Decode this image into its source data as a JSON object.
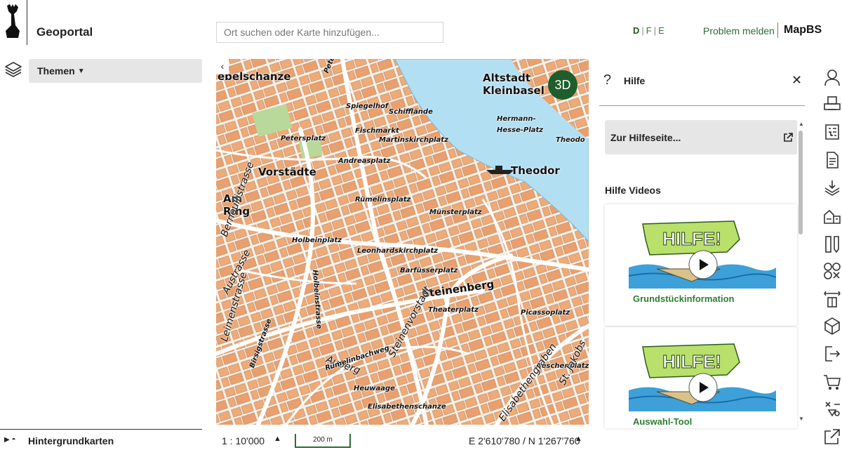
{
  "header": {
    "title": "Geoportal",
    "search_placeholder": "Ort suchen oder Karte hinzufügen...",
    "languages": [
      "D",
      "F",
      "E"
    ],
    "active_language": "D",
    "problem_link": "Problem melden",
    "brand": "MapBS"
  },
  "left_panel": {
    "themes_label": "Themen",
    "background_maps_label": "Hintergrundkarten"
  },
  "map": {
    "btn_3d": "3D",
    "labels": [
      {
        "text": "Altstadt",
        "cls": "big"
      },
      {
        "text": "Kleinbasel",
        "cls": "big"
      },
      {
        "text": "Vorstädte",
        "cls": "big"
      },
      {
        "text": "Am",
        "cls": "big"
      },
      {
        "text": "Ring",
        "cls": "big"
      },
      {
        "text": "Theodor",
        "cls": "big"
      },
      {
        "text": "ebelschanze",
        "cls": "big"
      },
      {
        "text": "Spiegelhof",
        "cls": "st"
      },
      {
        "text": "Schifflände",
        "cls": "st"
      },
      {
        "text": "Fischmarkt",
        "cls": "st"
      },
      {
        "text": "Martinskirchplatz",
        "cls": "st"
      },
      {
        "text": "Petersplatz",
        "cls": "st"
      },
      {
        "text": "Andreasplatz",
        "cls": "st"
      },
      {
        "text": "Rümelinsplatz",
        "cls": "st"
      },
      {
        "text": "Münsterplatz",
        "cls": "st"
      },
      {
        "text": "Holbeinplatz",
        "cls": "st"
      },
      {
        "text": "Leonhardskirchplatz",
        "cls": "st"
      },
      {
        "text": "Barfüsserplatz",
        "cls": "st"
      },
      {
        "text": "Steinenberg",
        "cls": "big"
      },
      {
        "text": "Theaterplatz",
        "cls": "st"
      },
      {
        "text": "Picassoplatz",
        "cls": "st"
      },
      {
        "text": "Aeschenplatz",
        "cls": "st"
      },
      {
        "text": "Heuwaage",
        "cls": "st"
      },
      {
        "text": "Elisabethenschanze",
        "cls": "st"
      },
      {
        "text": "Hermann-",
        "cls": "st"
      },
      {
        "text": "Hesse-Platz",
        "cls": "st"
      },
      {
        "text": "Theodo",
        "cls": "st"
      },
      {
        "text": "Petersgraben",
        "cls": "st"
      },
      {
        "text": "Leimenstrasse",
        "cls": "road"
      },
      {
        "text": "Austrasse",
        "cls": "road"
      },
      {
        "text": "Auberg",
        "cls": "road"
      },
      {
        "text": "Steinenvorstadt",
        "cls": "road"
      },
      {
        "text": "Rümelinbachweg",
        "cls": "st"
      },
      {
        "text": "Holbeinstrasse",
        "cls": "st"
      },
      {
        "text": "Birsigstrasse",
        "cls": "st"
      },
      {
        "text": "St. Jakobs",
        "cls": "road"
      },
      {
        "text": "Elisabethengraben",
        "cls": "road"
      },
      {
        "text": "Bernoullistrasse",
        "cls": "road"
      }
    ]
  },
  "status": {
    "scale": "1 : 10'000",
    "scalebar": "200 m",
    "coords": "E 2'610'780 / N 1'267'760"
  },
  "help": {
    "title": "Hilfe",
    "link_label": "Zur Hilfeseite...",
    "videos_heading": "Hilfe Videos",
    "videos": [
      {
        "label": "Grundstückinformation",
        "banner": "HILFE!"
      },
      {
        "label": "Auswahl-Tool",
        "banner": "HILFE!"
      }
    ]
  },
  "toolbar": {
    "icons": [
      "user-icon",
      "print-icon",
      "tree-list-icon",
      "document-icon",
      "layers-download-icon",
      "building-measure-icon",
      "ruler-pencil-icon",
      "shapes-icon",
      "compare-icon",
      "3d-box-icon",
      "export-icon",
      "cart-icon",
      "share-icon",
      "external-window-icon"
    ]
  },
  "colors": {
    "accent": "#1f5e2c",
    "link": "#2e6b37",
    "map_block": "#eeaa77",
    "map_water": "#b3dff2",
    "map_park": "#b9d99a"
  }
}
